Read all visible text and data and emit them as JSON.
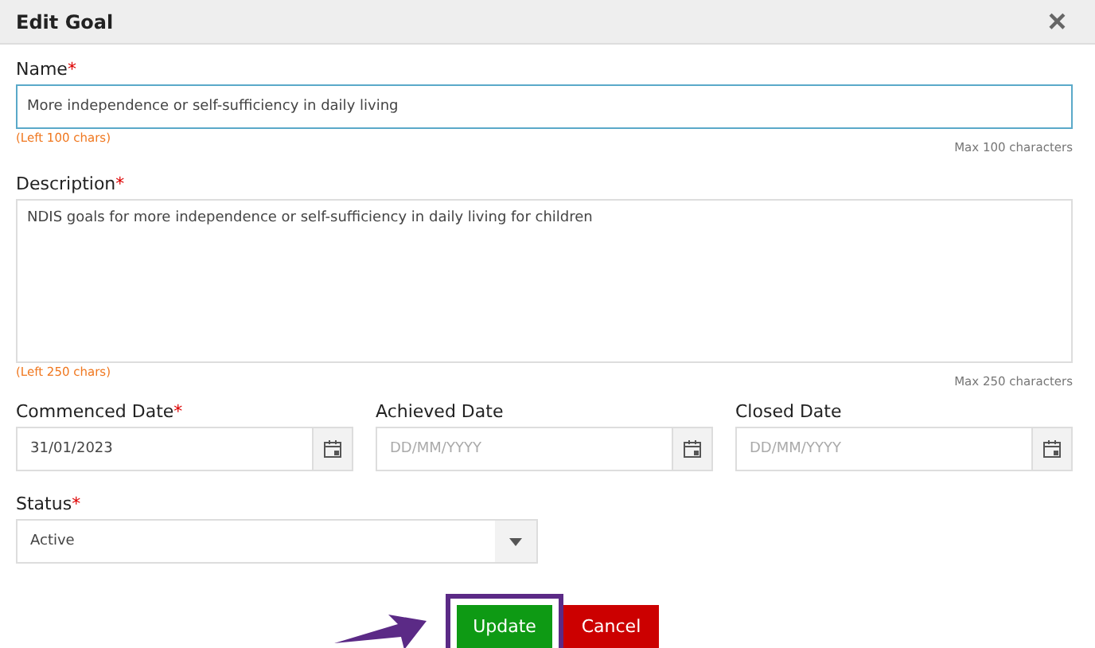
{
  "dialog": {
    "title": "Edit Goal",
    "close": "×"
  },
  "name_field": {
    "label": "Name",
    "required_mark": "*",
    "value": "More independence or self-sufficiency in daily living",
    "focused": true,
    "left_hint": "(Left 100 chars)",
    "max_hint": "Max 100 characters"
  },
  "description_field": {
    "label": "Description",
    "required_mark": "*",
    "value": "NDIS goals for more independence or self-sufficiency in daily living for children",
    "left_hint": "(Left 250 chars)",
    "max_hint": "Max 250 characters"
  },
  "date_fields": [
    {
      "label": "Commenced Date",
      "required_mark": "*",
      "value": "31/01/2023"
    },
    {
      "label": "Achieved Date",
      "placeholder": "DD/MM/YYYY"
    },
    {
      "label": "Closed Date",
      "placeholder": "DD/MM/YYYY"
    }
  ],
  "status_field": {
    "label": "Status",
    "required_mark": "*",
    "value": "Active"
  },
  "buttons": [
    {
      "label": "Update",
      "kind": "primary",
      "highlighted": true
    },
    {
      "label": "Cancel",
      "kind": "danger",
      "highlighted": false
    }
  ]
}
